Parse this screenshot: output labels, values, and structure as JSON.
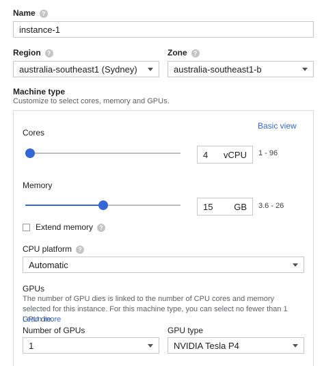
{
  "name": {
    "label": "Name",
    "value": "instance-1"
  },
  "region": {
    "label": "Region",
    "value": "australia-southeast1 (Sydney)"
  },
  "zone": {
    "label": "Zone",
    "value": "australia-southeast1-b"
  },
  "machine_type": {
    "label": "Machine type",
    "description": "Customize to select cores, memory and GPUs.",
    "basic_view_link": "Basic view"
  },
  "cores": {
    "label": "Cores",
    "value": "4",
    "unit": "vCPU",
    "range_text": "1 - 96",
    "slider_fraction": 0.032
  },
  "memory": {
    "label": "Memory",
    "value": "15",
    "unit": "GB",
    "range_text": "3.6 - 26",
    "slider_fraction": 0.502
  },
  "extend_memory": {
    "label": "Extend memory",
    "checked": false
  },
  "cpu_platform": {
    "label": "CPU platform",
    "value": "Automatic"
  },
  "gpus": {
    "title": "GPUs",
    "description": "The number of GPU dies is linked to the number of CPU cores and memory selected for this instance. For this machine type, you can select no fewer than 1 GPU die.",
    "learn_more": "Learn more",
    "number_label": "Number of GPUs",
    "number_value": "1",
    "type_label": "GPU type",
    "type_value": "NVIDIA Tesla P4"
  },
  "help_glyph": "?",
  "colors": {
    "accent": "#3367d6",
    "border": "#c8c8c8",
    "text": "#212121",
    "muted": "#5f6368"
  }
}
